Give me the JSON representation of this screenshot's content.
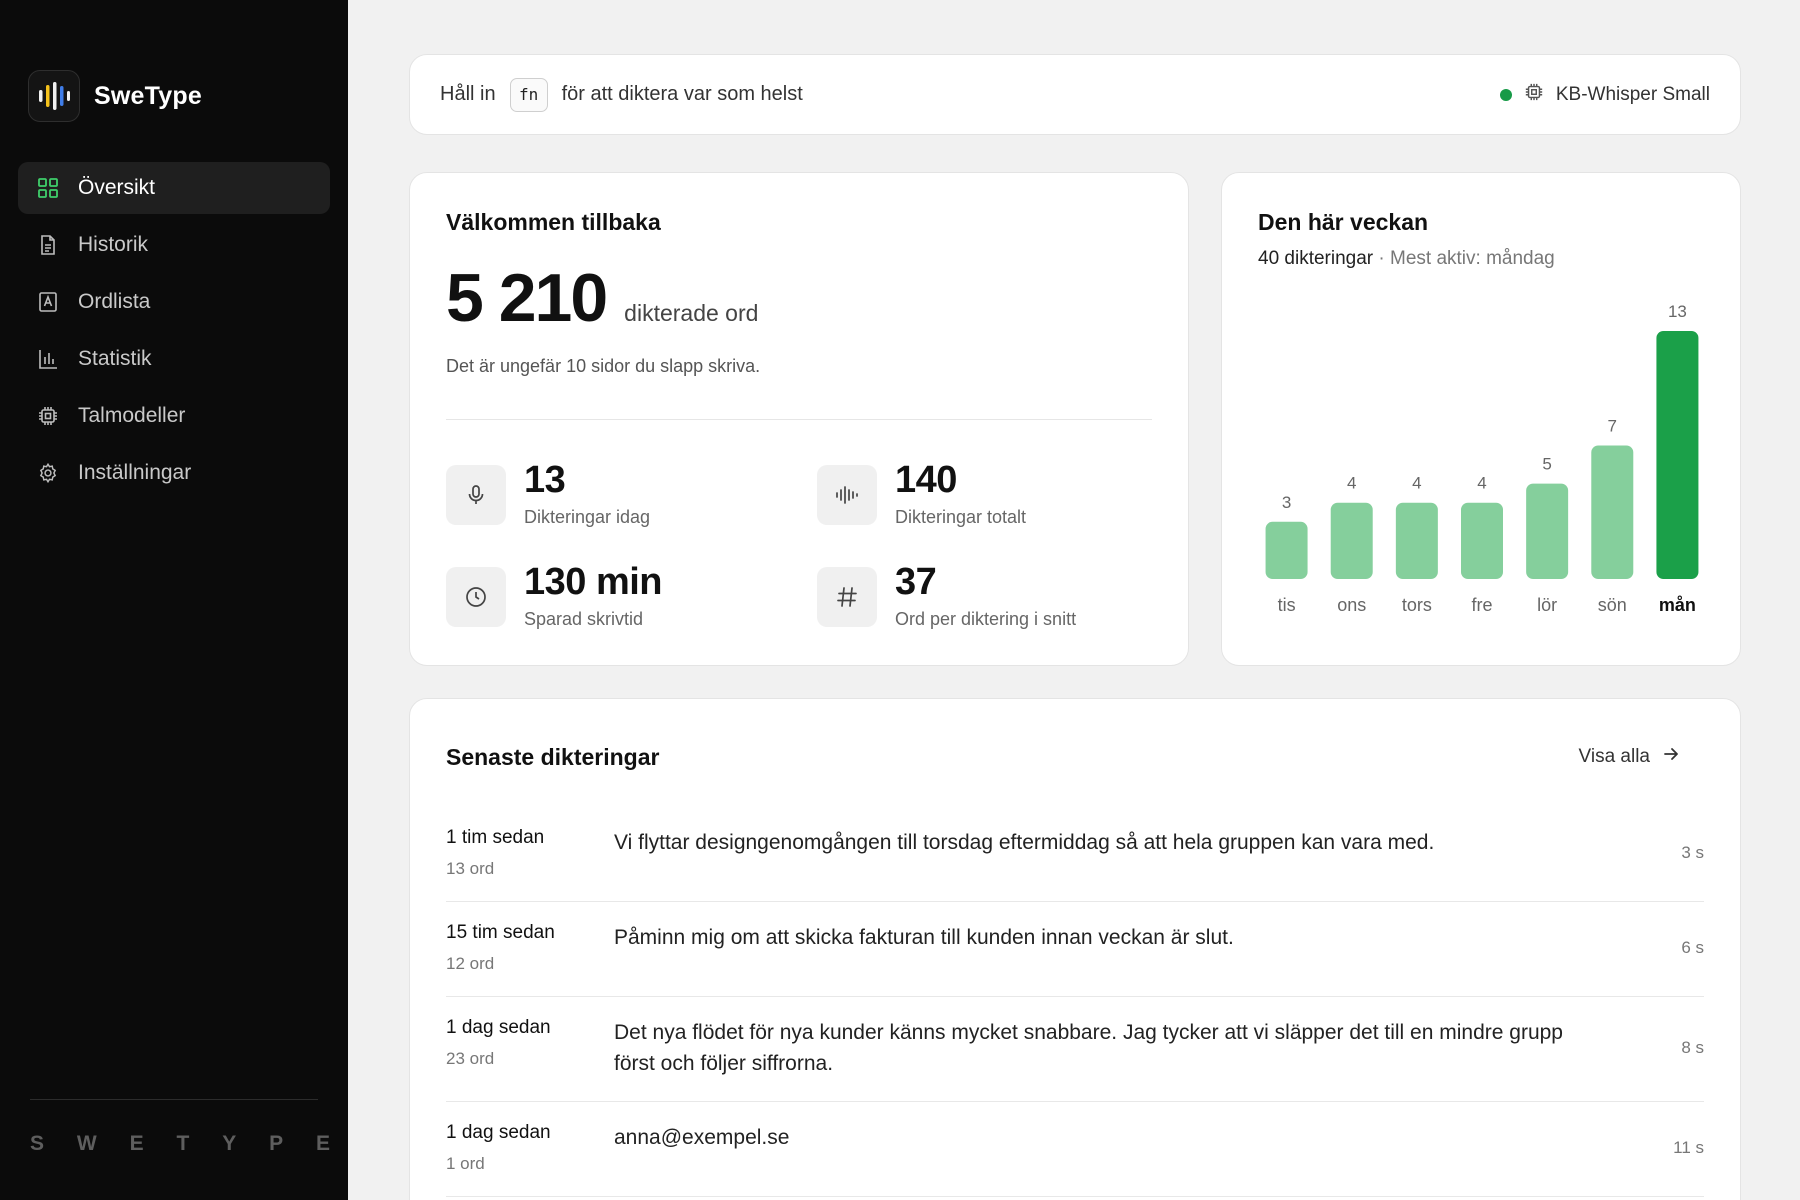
{
  "sidebar": {
    "brand": "SweType",
    "items": [
      {
        "label": "Översikt",
        "icon": "grid-icon",
        "active": true
      },
      {
        "label": "Historik",
        "icon": "document-icon",
        "active": false
      },
      {
        "label": "Ordlista",
        "icon": "dictionary-icon",
        "active": false
      },
      {
        "label": "Statistik",
        "icon": "bar-chart-icon",
        "active": false
      },
      {
        "label": "Talmodeller",
        "icon": "chip-icon",
        "active": false
      },
      {
        "label": "Inställningar",
        "icon": "gear-icon",
        "active": false
      }
    ],
    "wordmark": [
      "S",
      "W",
      "E",
      "T",
      "Y",
      "P",
      "E"
    ]
  },
  "topbar": {
    "hold_text": "Håll in",
    "key": "fn",
    "dictate_text": "för att diktera var som helst",
    "model": "KB-Whisper Small",
    "status_color": "#179a47"
  },
  "welcome": {
    "title": "Välkommen tillbaka",
    "words_count": "5 210",
    "words_label": "dikterade ord",
    "subtext": "Det är ungefär 10 sidor du slapp skriva.",
    "stats": [
      {
        "value": "13",
        "label": "Dikteringar idag",
        "icon": "microphone-icon"
      },
      {
        "value": "140",
        "label": "Dikteringar totalt",
        "icon": "waveform-icon"
      },
      {
        "value": "130 min",
        "label": "Sparad skrivtid",
        "icon": "clock-icon"
      },
      {
        "value": "37",
        "label": "Ord per diktering i snitt",
        "icon": "hash-icon"
      }
    ]
  },
  "week": {
    "title": "Den här veckan",
    "count": "40 dikteringar",
    "most_active": " · Mest aktiv: måndag"
  },
  "chart_data": {
    "type": "bar",
    "categories": [
      "tis",
      "ons",
      "tors",
      "fre",
      "lör",
      "sön",
      "mån"
    ],
    "values": [
      3,
      4,
      4,
      4,
      5,
      7,
      13
    ],
    "highlight": "mån",
    "title": "",
    "xlabel": "",
    "ylabel": "",
    "ylim": [
      0,
      13
    ],
    "bar_color": "#85cf9c",
    "highlight_color": "#1ba049"
  },
  "recent": {
    "title": "Senaste dikteringar",
    "view_all": "Visa alla",
    "rows": [
      {
        "time": "1 tim sedan",
        "words": "13 ord",
        "text": "Vi flyttar designgenomgången till torsdag eftermiddag så att hela gruppen kan vara med.",
        "duration": "3 s"
      },
      {
        "time": "15 tim sedan",
        "words": "12 ord",
        "text": "Påminn mig om att skicka fakturan till kunden innan veckan är slut.",
        "duration": "6 s"
      },
      {
        "time": "1 dag sedan",
        "words": "23 ord",
        "text": "Det nya flödet för nya kunder känns mycket snabbare. Jag tycker att vi släpper det till en mindre grupp först och följer siffrorna.",
        "duration": "8 s"
      },
      {
        "time": "1 dag sedan",
        "words": "1 ord",
        "text": "anna@exempel.se",
        "duration": "11 s"
      }
    ]
  }
}
